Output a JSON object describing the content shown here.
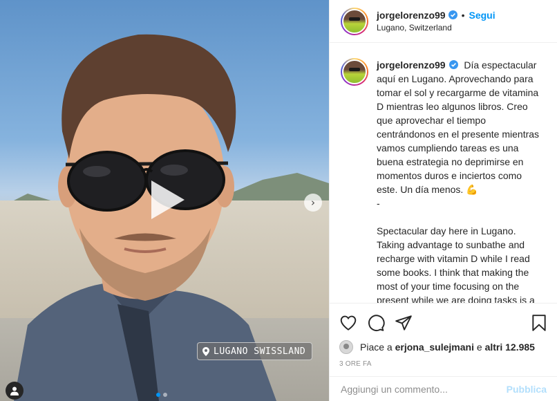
{
  "post": {
    "username": "jorgelorenzo99",
    "separator": "•",
    "follow_label": "Segui",
    "location": "Lugano, Switzerland"
  },
  "media": {
    "sticker_text": "LUGANO SWISSLAND",
    "next_arrow": "›",
    "carousel_dots": 2,
    "active_dot": 0
  },
  "caption": {
    "username": "jorgelorenzo99",
    "spanish_text": "Día espectacular aquí en Lugano. Aprovechando para tomar el sol y recargarme de vitamina D mientras leo algunos libros. Creo que aprovechar el tiempo centrándonos en el presente mientras vamos cumpliendo tareas es una buena estrategia no deprimirse en momentos duros e inciertos como este. Un día menos. 💪",
    "dash": "-",
    "english_text": "Spectacular day here in Lugano. Taking advantage to sunbathe and recharge with vitamin D while I read some books. I think that making the most of your time focusing on the present while we are doing tasks is a good strategy not to get depressed in"
  },
  "likes": {
    "prefix": "Piace a",
    "liker": "erjona_sulejmani",
    "connector": "e",
    "others": "altri 12.985"
  },
  "time_ago": "3 ORE FA",
  "comment": {
    "placeholder": "Aggiungi un commento...",
    "publish_label": "Pubblica"
  },
  "icons": {
    "like": "heart-icon",
    "comment": "comment-icon",
    "share": "share-icon",
    "save": "bookmark-icon"
  },
  "colors": {
    "accent": "#0095f6",
    "publish_disabled": "#b2dffc",
    "verified": "#3897f0"
  }
}
